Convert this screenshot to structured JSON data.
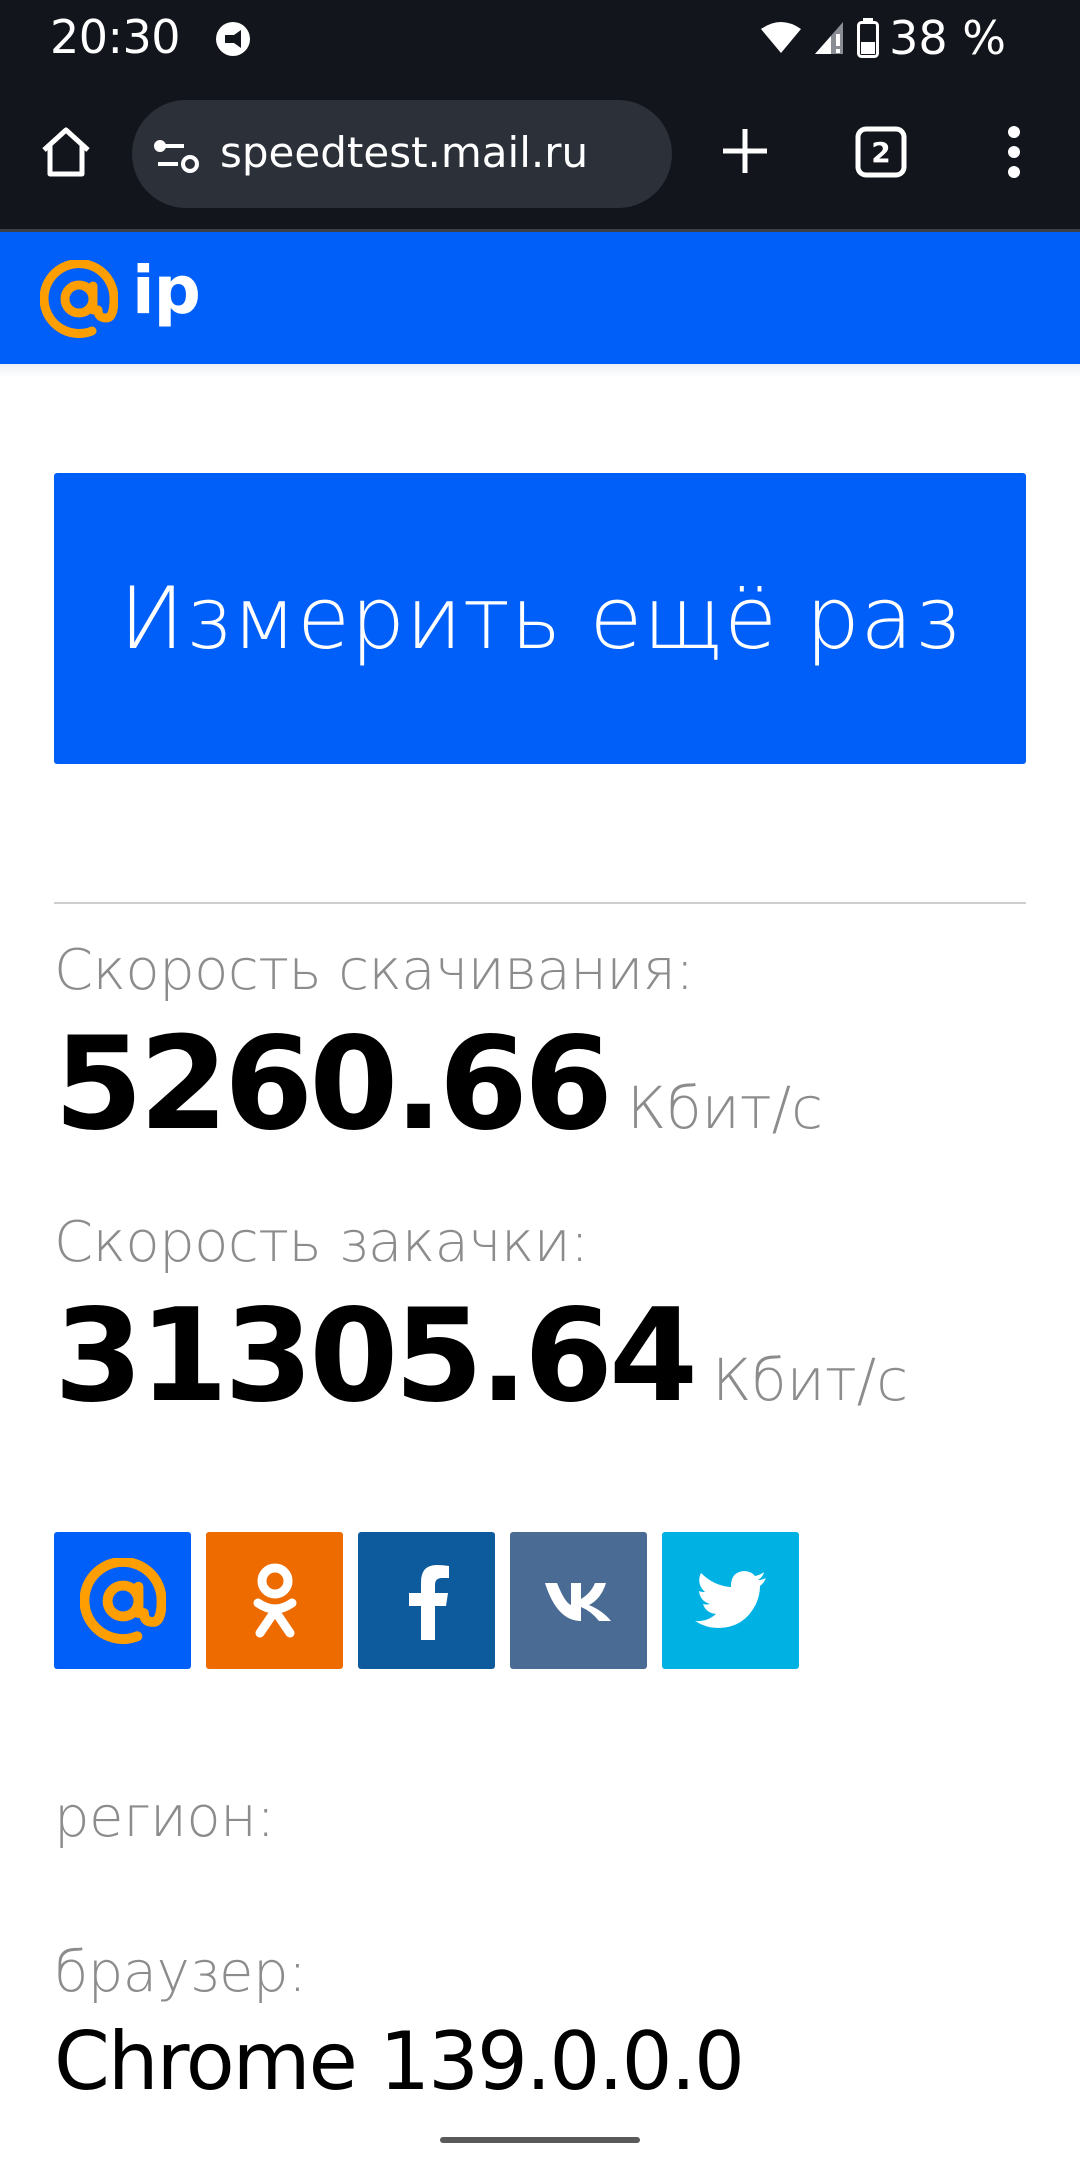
{
  "status_bar": {
    "time": "20:30",
    "battery_percent": "38 %",
    "icons": [
      "notification-icon",
      "wifi-icon",
      "cellular-signal-icon",
      "battery-icon"
    ]
  },
  "browser": {
    "url": "speedtest.mail.ru",
    "tab_count": "2",
    "icons": [
      "home-icon",
      "site-settings-icon",
      "plus-icon",
      "tab-switcher-icon",
      "more-vert-icon"
    ]
  },
  "header": {
    "logo_text": "ip",
    "colors": {
      "background": "#005ff9",
      "logo_at": "#ff9e00"
    }
  },
  "main": {
    "retest_button": "Измерить ещё раз",
    "download": {
      "label": "Скорость скачивания:",
      "value": "5260.66",
      "unit": "Кбит/с"
    },
    "upload": {
      "label": "Скорость закачки:",
      "value": "31305.64",
      "unit": "Кбит/с"
    },
    "share_buttons": [
      {
        "name": "mail-ru-icon",
        "color": "#005ff9"
      },
      {
        "name": "odnoklassniki-icon",
        "color": "#ee6b00"
      },
      {
        "name": "facebook-icon",
        "color": "#0d5a9c"
      },
      {
        "name": "vk-icon",
        "color": "#4a6b93"
      },
      {
        "name": "twitter-icon",
        "color": "#00b2e3"
      }
    ],
    "region_label": "регион:",
    "browser_label": "браузер:",
    "browser_value": "Chrome 139.0.0.0"
  }
}
